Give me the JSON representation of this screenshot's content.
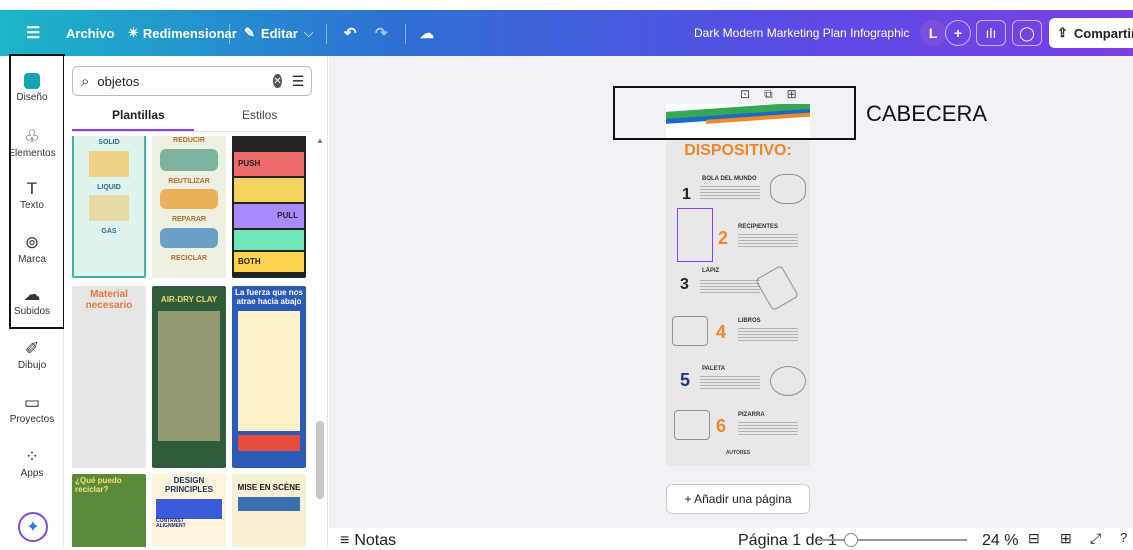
{
  "topbar": {
    "menu_icon": "hamburger-icon",
    "file_label": "Archivo",
    "resize_label": "Redimensionar",
    "edit_label": "Editar",
    "doc_title": "Dark Modern Marketing Plan Infographic",
    "avatar_initial": "L",
    "add_label": "+",
    "share_label": "Compartir"
  },
  "rail": {
    "items": [
      {
        "label": "Diseño",
        "icon": "design-icon"
      },
      {
        "label": "Elementos",
        "icon": "elements-icon"
      },
      {
        "label": "Texto",
        "icon": "text-icon"
      },
      {
        "label": "Marca",
        "icon": "brand-icon"
      },
      {
        "label": "Subidos",
        "icon": "uploads-icon"
      },
      {
        "label": "Dibujo",
        "icon": "draw-icon"
      },
      {
        "label": "Proyectos",
        "icon": "folder-icon"
      },
      {
        "label": "Apps",
        "icon": "apps-icon"
      }
    ]
  },
  "panel": {
    "search_value": "objetos",
    "tabs": [
      "Plantillas",
      "Estilos"
    ],
    "templates": {
      "t1": {
        "labels": [
          "SOLID",
          "LIQUID",
          "GAS"
        ]
      },
      "t2": {
        "labels": [
          "REDUCIR",
          "REUTILIZAR",
          "REPARAR",
          "RECICLAR"
        ]
      },
      "t3": {
        "labels": [
          "PUSH",
          "PULL",
          "BOTH"
        ]
      },
      "t4": {
        "title": "Material necesario"
      },
      "t5": {
        "title": "AIR-DRY CLAY"
      },
      "t6": {
        "title": "La fuerza que nos atrae hacia abajo"
      },
      "t7": {
        "title": "¿Qué puedo reciclar?"
      },
      "t8": {
        "title": "DESIGN PRINCIPLES",
        "sub": "CONTRAST",
        "sub2": "ALIGNMENT"
      },
      "t9": {
        "title": "MISE EN SCÈNE"
      }
    }
  },
  "canvas": {
    "infographic": {
      "title": "DISPOSITIVO:",
      "rows": [
        {
          "num": "1",
          "label": "BOLA DEL MUNDO",
          "color": "#222222"
        },
        {
          "num": "2",
          "label": "RECIPIENTES",
          "color": "#f0842a"
        },
        {
          "num": "3",
          "label": "LÁPIZ",
          "color": "#222222"
        },
        {
          "num": "4",
          "label": "LIBROS",
          "color": "#f0842a"
        },
        {
          "num": "5",
          "label": "PALETA",
          "color": "#1b3a8a"
        },
        {
          "num": "6",
          "label": "PIZARRA",
          "color": "#f0842a"
        }
      ],
      "footer": "AUTORES"
    },
    "annotation": "CABECERA",
    "add_page": "+ Añadir una página"
  },
  "bottombar": {
    "notes": "Notas",
    "page_info": "Página 1 de 1",
    "zoom": "24 %",
    "zoom_fraction": 0.24
  },
  "colors": {
    "accent": "#8b3dff",
    "orange": "#f0842a",
    "teal": "#17a2b8"
  }
}
